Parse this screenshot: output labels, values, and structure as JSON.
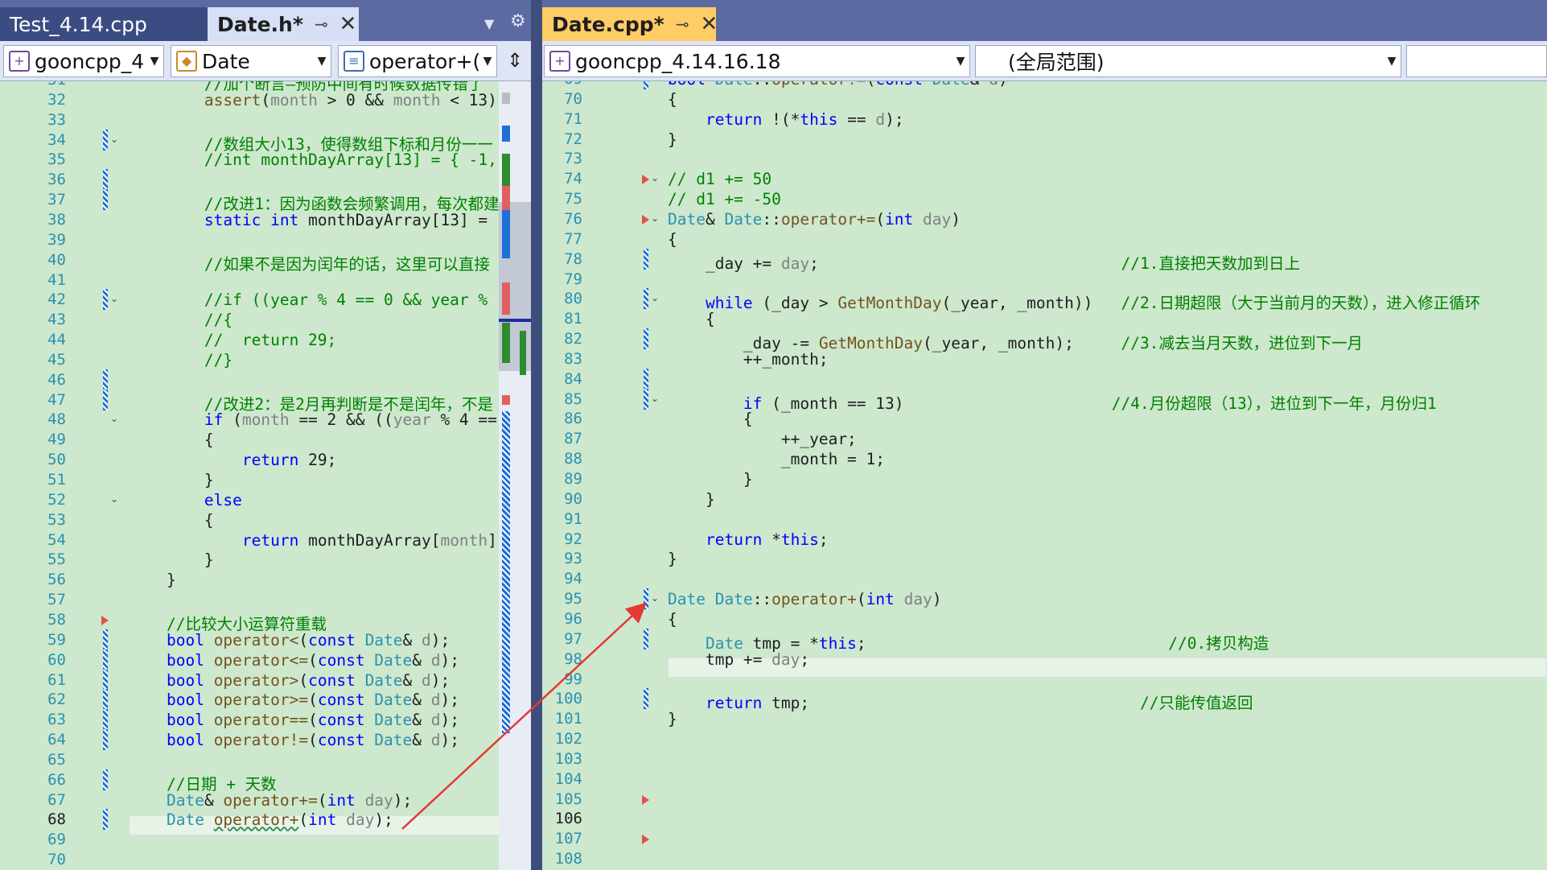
{
  "left": {
    "tabs": [
      {
        "label": "Test_4.14.cpp"
      },
      {
        "label": "Date.h*"
      }
    ],
    "nav": {
      "project": "gooncpp_4.",
      "class": "Date",
      "member": "operator+(i"
    },
    "lines": [
      {
        "n": "31",
        "html": "        <span class='cm'>//加个断言—预防中间有时候数据传错了</span>"
      },
      {
        "n": "32",
        "html": "        <span class='fn'>assert</span>(<span class='pr'>month</span> &gt; 0 &amp;&amp; <span class='pr'>month</span> &lt; 13);"
      },
      {
        "n": "33",
        "html": ""
      },
      {
        "n": "34",
        "html": "        <span class='cm'>//数组大小13，使得数组下标和月份一一</span>"
      },
      {
        "n": "35",
        "html": "        <span class='cm'>//int monthDayArray[13] = { -1,</span>"
      },
      {
        "n": "36",
        "html": ""
      },
      {
        "n": "37",
        "html": "        <span class='cm'>//改进1：因为函数会频繁调用，每次都建</span>"
      },
      {
        "n": "38",
        "html": "        <span class='kw'>static</span> <span class='kw'>int</span> monthDayArray[13] = {"
      },
      {
        "n": "39",
        "html": ""
      },
      {
        "n": "40",
        "html": "        <span class='cm'>//如果不是因为闰年的话，这里可以直接</span>"
      },
      {
        "n": "41",
        "html": ""
      },
      {
        "n": "42",
        "html": "        <span class='cm'>//if ((year % 4 == 0 &amp;&amp; year % 1</span>"
      },
      {
        "n": "43",
        "html": "        <span class='cm'>//{</span>"
      },
      {
        "n": "44",
        "html": "        <span class='cm'>//  return 29;</span>"
      },
      {
        "n": "45",
        "html": "        <span class='cm'>//}</span>"
      },
      {
        "n": "46",
        "html": ""
      },
      {
        "n": "47",
        "html": "        <span class='cm'>//改进2：是2月再判断是不是闰年，不是</span>"
      },
      {
        "n": "48",
        "html": "        <span class='kw'>if</span> (<span class='pr'>month</span> == 2 &amp;&amp; ((<span class='pr'>year</span> % 4 =="
      },
      {
        "n": "49",
        "html": "        {"
      },
      {
        "n": "50",
        "html": "            <span class='kw'>return</span> 29;"
      },
      {
        "n": "51",
        "html": "        }"
      },
      {
        "n": "52",
        "html": "        <span class='kw'>else</span>"
      },
      {
        "n": "53",
        "html": "        {"
      },
      {
        "n": "54",
        "html": "            <span class='kw'>return</span> monthDayArray[<span class='pr'>month</span>]"
      },
      {
        "n": "55",
        "html": "        }"
      },
      {
        "n": "56",
        "html": "    }"
      },
      {
        "n": "57",
        "html": ""
      },
      {
        "n": "58",
        "html": "    <span class='cm'>//比较大小运算符重载</span>"
      },
      {
        "n": "59",
        "html": "    <span class='kw'>bool</span> <span class='fn'>operator&lt;</span>(<span class='kw'>const</span> <span class='ty'>Date</span>&amp; <span class='pr'>d</span>);"
      },
      {
        "n": "60",
        "html": "    <span class='kw'>bool</span> <span class='fn'>operator&lt;=</span>(<span class='kw'>const</span> <span class='ty'>Date</span>&amp; <span class='pr'>d</span>);"
      },
      {
        "n": "61",
        "html": "    <span class='kw'>bool</span> <span class='fn'>operator&gt;</span>(<span class='kw'>const</span> <span class='ty'>Date</span>&amp; <span class='pr'>d</span>);"
      },
      {
        "n": "62",
        "html": "    <span class='kw'>bool</span> <span class='fn'>operator&gt;=</span>(<span class='kw'>const</span> <span class='ty'>Date</span>&amp; <span class='pr'>d</span>);"
      },
      {
        "n": "63",
        "html": "    <span class='kw'>bool</span> <span class='fn'>operator==</span>(<span class='kw'>const</span> <span class='ty'>Date</span>&amp; <span class='pr'>d</span>);"
      },
      {
        "n": "64",
        "html": "    <span class='kw'>bool</span> <span class='fn'>operator!=</span>(<span class='kw'>const</span> <span class='ty'>Date</span>&amp; <span class='pr'>d</span>);"
      },
      {
        "n": "65",
        "html": ""
      },
      {
        "n": "66",
        "html": "    <span class='cm'>//日期 + 天数</span>"
      },
      {
        "n": "67",
        "html": "    <span class='ty'>Date</span>&amp; <span class='fn'>operator+=</span>(<span class='kw'>int</span> <span class='pr'>day</span>);"
      },
      {
        "n": "68",
        "html": "    <span class='ty'>Date</span> <span class='fn' style='text-decoration:underline wavy #2e8b57'>operator+</span>(<span class='kw'>int</span> <span class='pr'>day</span>);"
      },
      {
        "n": "69",
        "html": ""
      },
      {
        "n": "70",
        "html": ""
      }
    ]
  },
  "right": {
    "tabs": [
      {
        "label": "Date.cpp*"
      }
    ],
    "nav": {
      "project": "gooncpp_4.14.16.18",
      "scope": "(全局范围)"
    },
    "lines": [
      {
        "n": "69",
        "html": "<span class='kw'>bool</span> <span class='ty'>Date</span>::<span class='fn'>operator!=</span>(<span class='kw'>const</span> <span class='ty'>Date</span>&amp; <span class='pr'>d</span>)"
      },
      {
        "n": "70",
        "html": "{"
      },
      {
        "n": "71",
        "html": "    <span class='kw'>return</span> !(*<span class='kw'>this</span> == <span class='pr'>d</span>);"
      },
      {
        "n": "72",
        "html": "}"
      },
      {
        "n": "73",
        "html": ""
      },
      {
        "n": "74",
        "html": "<span class='cm'>// d1 += 50</span>"
      },
      {
        "n": "75",
        "html": "<span class='cm'>// d1 += -50</span>"
      },
      {
        "n": "76",
        "html": "<span class='ty'>Date</span>&amp; <span class='ty'>Date</span>::<span class='fn'>operator+=</span>(<span class='kw'>int</span> <span class='pr'>day</span>)"
      },
      {
        "n": "77",
        "html": "{"
      },
      {
        "n": "78",
        "html": "    _day += <span class='pr'>day</span>;                                <span class='cm'>//1.直接把天数加到日上</span>"
      },
      {
        "n": "79",
        "html": ""
      },
      {
        "n": "80",
        "html": "    <span class='kw'>while</span> (_day &gt; <span class='fn'>GetMonthDay</span>(_year, _month))   <span class='cm'>//2.日期超限（大于当前月的天数），进入修正循环</span>"
      },
      {
        "n": "81",
        "html": "    {"
      },
      {
        "n": "82",
        "html": "        _day -= <span class='fn'>GetMonthDay</span>(_year, _month);     <span class='cm'>//3.减去当月天数，进位到下一月</span>"
      },
      {
        "n": "83",
        "html": "        ++_month;"
      },
      {
        "n": "84",
        "html": ""
      },
      {
        "n": "85",
        "html": "        <span class='kw'>if</span> (_month == 13)                      <span class='cm'>//4.月份超限（13），进位到下一年，月份归1</span>"
      },
      {
        "n": "86",
        "html": "        {"
      },
      {
        "n": "87",
        "html": "            ++_year;"
      },
      {
        "n": "88",
        "html": "            _month = 1;"
      },
      {
        "n": "89",
        "html": "        }"
      },
      {
        "n": "90",
        "html": "    }"
      },
      {
        "n": "91",
        "html": ""
      },
      {
        "n": "92",
        "html": "    <span class='kw'>return</span> *<span class='kw'>this</span>;"
      },
      {
        "n": "93",
        "html": "}"
      },
      {
        "n": "94",
        "html": ""
      },
      {
        "n": "95",
        "html": "<span class='ty'>Date</span> <span class='ty'>Date</span>::<span class='fn'>operator+</span>(<span class='kw'>int</span> <span class='pr'>day</span>)"
      },
      {
        "n": "96",
        "html": "{"
      },
      {
        "n": "97",
        "html": "    <span class='ty'>Date</span> tmp = *<span class='kw'>this</span>;                                <span class='cm'>//0.拷贝构造</span>"
      },
      {
        "n": "98",
        "html": "    tmp += <span class='pr'>day</span>;"
      },
      {
        "n": "99",
        "html": ""
      },
      {
        "n": "100",
        "html": "    <span class='kw'>return</span> tmp;                                   <span class='cm'>//只能传值返回</span>"
      },
      {
        "n": "101",
        "html": "}"
      },
      {
        "n": "102",
        "html": ""
      },
      {
        "n": "103",
        "html": ""
      },
      {
        "n": "104",
        "html": ""
      },
      {
        "n": "105",
        "html": ""
      },
      {
        "n": "106",
        "html": ""
      },
      {
        "n": "107",
        "html": ""
      },
      {
        "n": "108",
        "html": ""
      }
    ]
  },
  "icons": {
    "pin": "⊸",
    "close": "✕",
    "gear": "⚙",
    "dropdown": "▼",
    "split": "⇕"
  },
  "colors": {
    "editor_bg": "#cde8cd",
    "keyword": "#0000ff",
    "comment": "#008000",
    "type": "#2b91af",
    "annotation_arrow": "#e53935"
  }
}
